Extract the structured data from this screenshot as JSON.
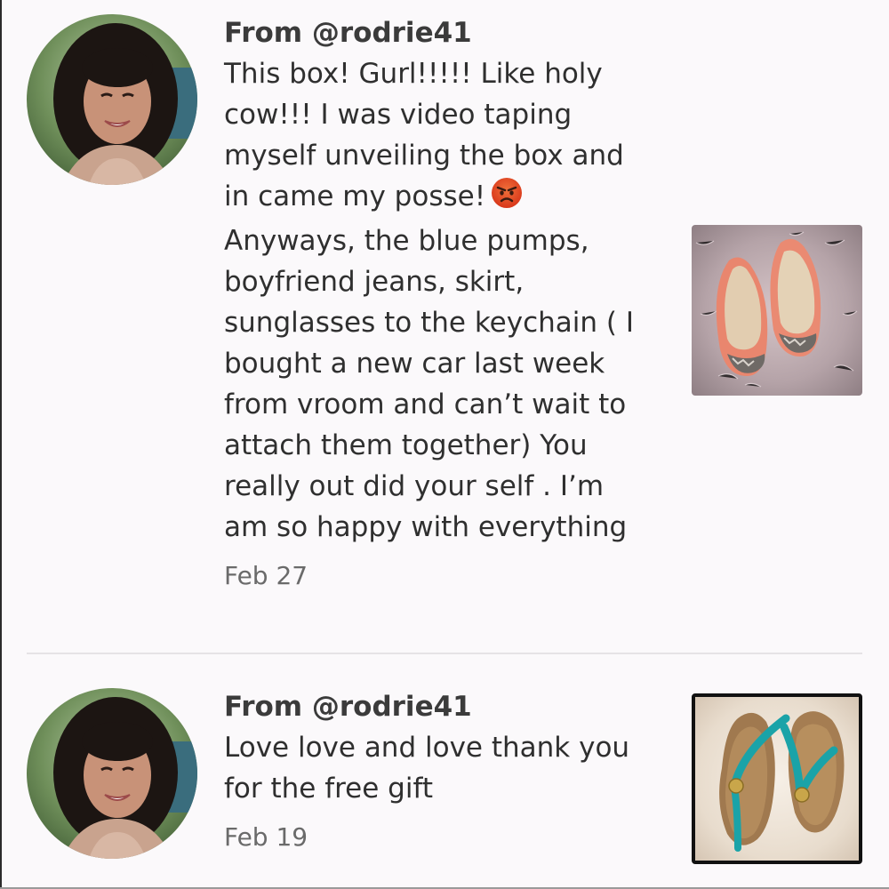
{
  "comments": [
    {
      "author": "From @rodrie41",
      "text_lines": [
        "This box! Gurl!!!!! Like holy",
        "cow!!!  I was video taping",
        "myself unveiling the box and",
        "in came my posse!",
        "Anyways, the blue pumps,",
        "boyfriend jeans, skirt,",
        "sunglasses to the keychain ( I",
        "bought a new car last week",
        "from vroom and can’t wait to",
        "attach them together)  You",
        "really out did your self . I’m",
        "am so happy with everything"
      ],
      "emoji": "angry-face-emoji",
      "date": "Feb 27",
      "thumbnail": "coral-flats-photo"
    },
    {
      "author": "From @rodrie41",
      "text_lines": [
        "Love love and love thank you",
        "for the free gift"
      ],
      "date": "Feb 19",
      "thumbnail": "teal-flip-flops-photo"
    }
  ],
  "colors": {
    "background": "#fbf9fb",
    "text": "#2f2f2f",
    "date": "#6a6a6a",
    "divider": "#e6e3e6"
  }
}
